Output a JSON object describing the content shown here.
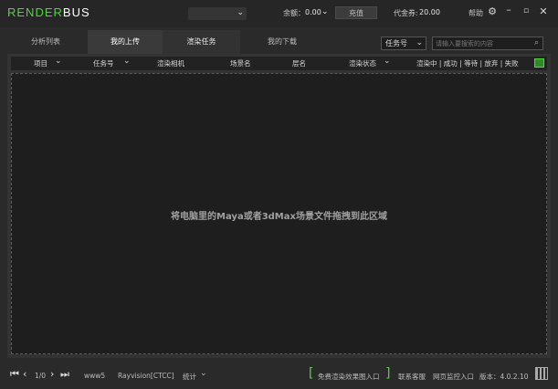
{
  "app": {
    "logo_main": "RENDER",
    "logo_tail": "BUS"
  },
  "topbar": {
    "account": "",
    "balance_label": "余额：",
    "balance_value": "0.00",
    "recharge": "充值",
    "voucher_label": "代金券:",
    "voucher_value": "20.00",
    "help": "帮助",
    "icons": [
      "gear-icon",
      "minimize-icon",
      "maximize-icon",
      "close-icon"
    ]
  },
  "tabs": [
    {
      "label": "分析列表",
      "state": "normal"
    },
    {
      "label": "我的上传",
      "state": "active"
    },
    {
      "label": "渲染任务",
      "state": "semi"
    },
    {
      "label": "我的下载",
      "state": "normal"
    }
  ],
  "filter": {
    "selected": "任务号",
    "search_placeholder": "请输入要搜索的内容"
  },
  "table": {
    "columns": [
      "项目",
      "任务号",
      "渲染相机",
      "场景名",
      "层名",
      "渲染状态",
      "渲染中 | 成功 | 等待 | 放弃 | 失败"
    ]
  },
  "drop_area": {
    "text": "将电脑里的Maya或者3dMax场景文件拖拽到此区域"
  },
  "footer": {
    "page": "1/0",
    "user": "www5",
    "server": "Rayvision[CTCC]",
    "stats": "统计",
    "free_render": "免费渲染效果图入口",
    "contact": "联系客服",
    "web_monitor": "网页监控入口",
    "version": "版本：4.0.2.10"
  },
  "colors": {
    "accent": "#4ed73a",
    "background": "#2a2a2a",
    "panel": "#1e1e1e"
  }
}
